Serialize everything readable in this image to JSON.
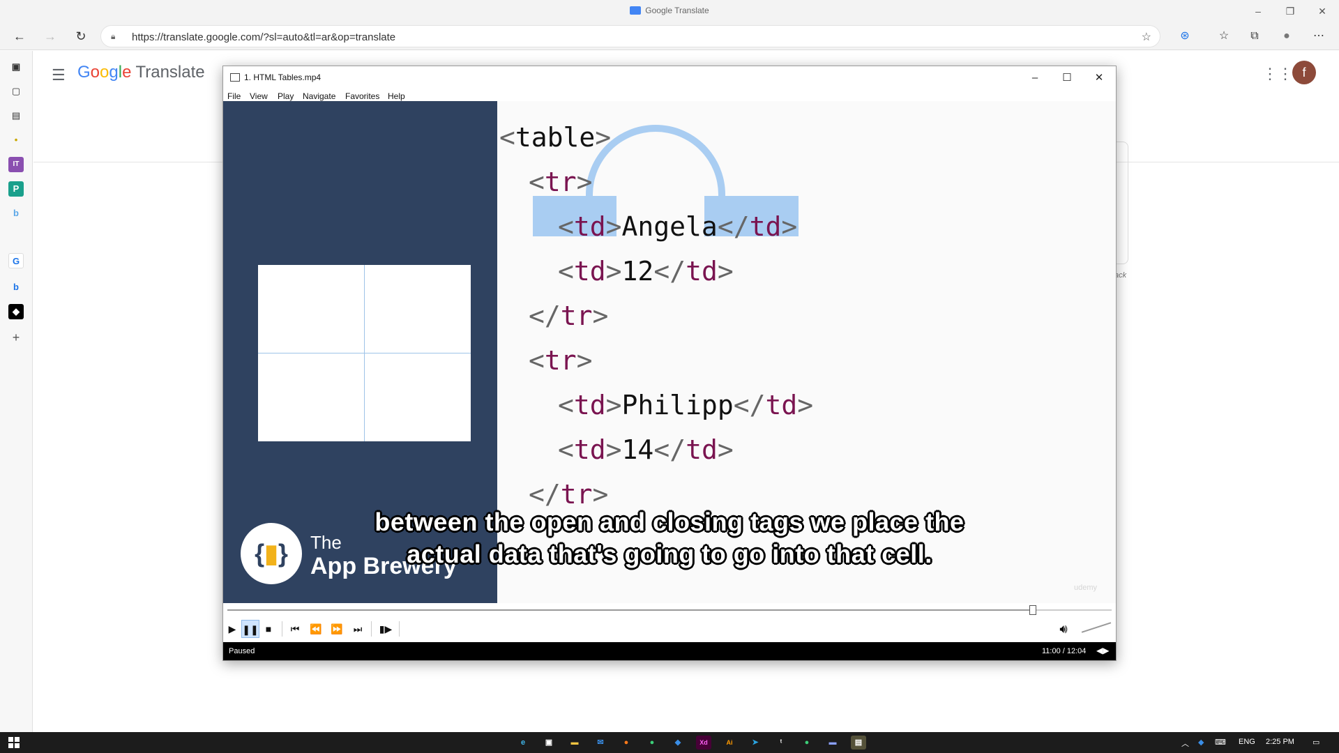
{
  "browser": {
    "window_title": "Google Translate",
    "url": "https://translate.google.com/?sl=auto&tl=ar&op=translate"
  },
  "google_translate": {
    "logo_google": [
      "G",
      "o",
      "o",
      "g",
      "l",
      "e"
    ],
    "logo_product": "Translate",
    "avatar_initial": "f",
    "feedback_text": "ack"
  },
  "player": {
    "title": "1. HTML Tables.mp4",
    "menu": [
      "File",
      "View",
      "Play",
      "Navigate",
      "Favorites",
      "Help"
    ],
    "status": "Paused",
    "time": "11:00 / 12:04",
    "progress": 0.911
  },
  "video": {
    "code_lines": {
      "table_open": "table",
      "tr1_open": "tr",
      "td_name1": "Angela",
      "td_age1": "12",
      "tr1_close": "tr",
      "tr2_open": "tr",
      "td_name2": "Philipp",
      "td_age2": "14",
      "tr2_close": "tr"
    },
    "td_tag": "td",
    "brand_the": "The",
    "brand_name": "App Brewery",
    "subtitle_line1": "between the open and closing tags we place the",
    "subtitle_line2": "actual data that's going to go into that cell.",
    "watermark": "udemy"
  },
  "taskbar": {
    "lang": "ENG",
    "time": "2:25 PM"
  },
  "colors": {
    "slide_dark": "#2f4260",
    "tag_color": "#7a1450",
    "highlight": "#a9cdf2"
  }
}
